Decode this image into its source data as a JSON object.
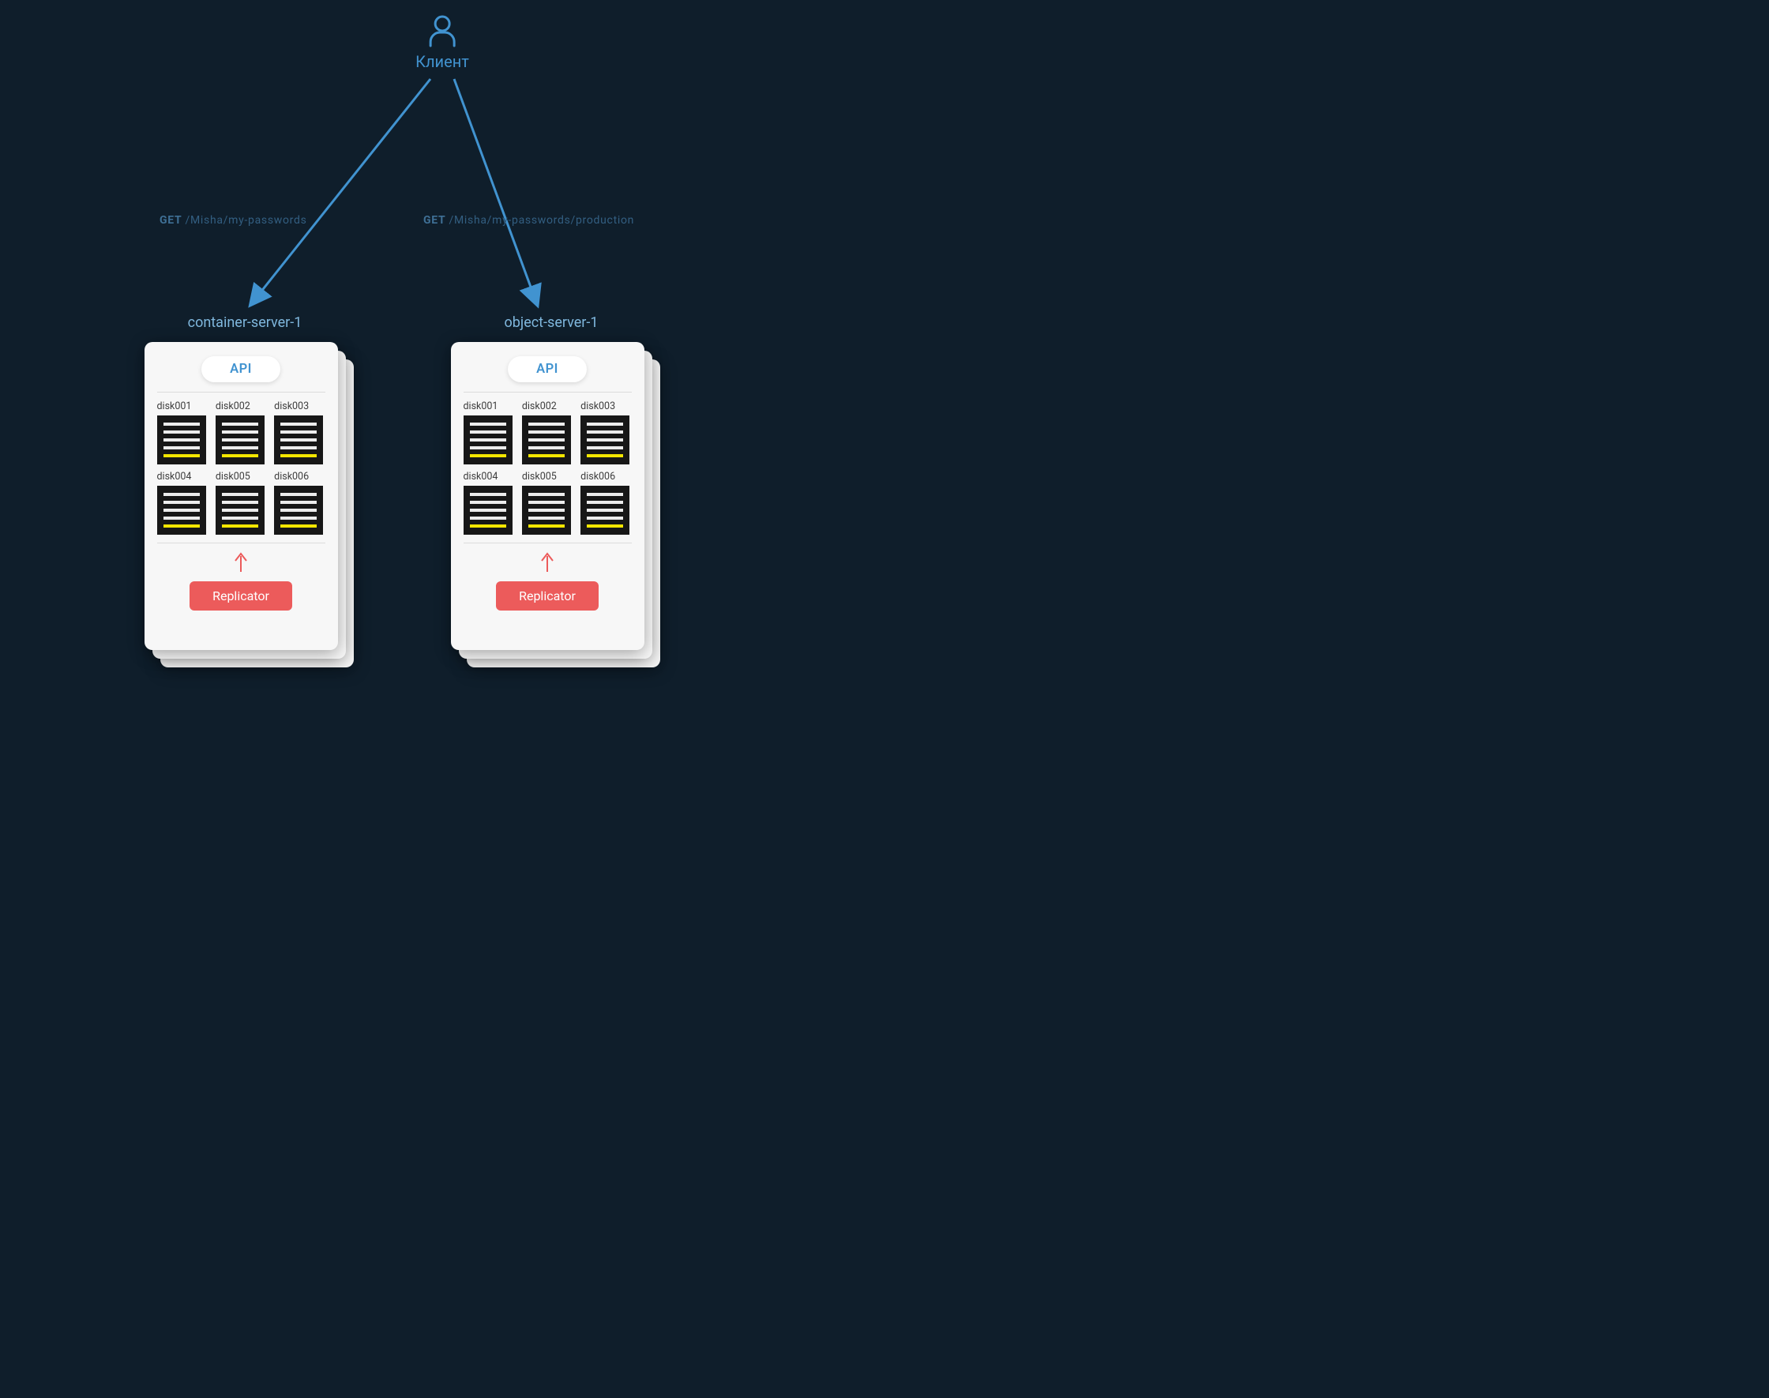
{
  "client": {
    "label": "Клиент"
  },
  "requests": {
    "left": {
      "method": "GET",
      "path": "/Misha/my-passwords"
    },
    "right": {
      "method": "GET",
      "path": "/Misha/my-passwords/production"
    }
  },
  "servers": {
    "left": {
      "title": "container-server-1",
      "api_label": "API",
      "disks": [
        "disk001",
        "disk002",
        "disk003",
        "disk004",
        "disk005",
        "disk006"
      ],
      "replicator_label": "Replicator"
    },
    "right": {
      "title": "object-server-1",
      "api_label": "API",
      "disks": [
        "disk001",
        "disk002",
        "disk003",
        "disk004",
        "disk005",
        "disk006"
      ],
      "replicator_label": "Replicator"
    }
  },
  "colors": {
    "bg": "#0f1e2b",
    "blue": "#4193d0",
    "red": "#ec5b5b",
    "yellow": "#f3e600"
  }
}
